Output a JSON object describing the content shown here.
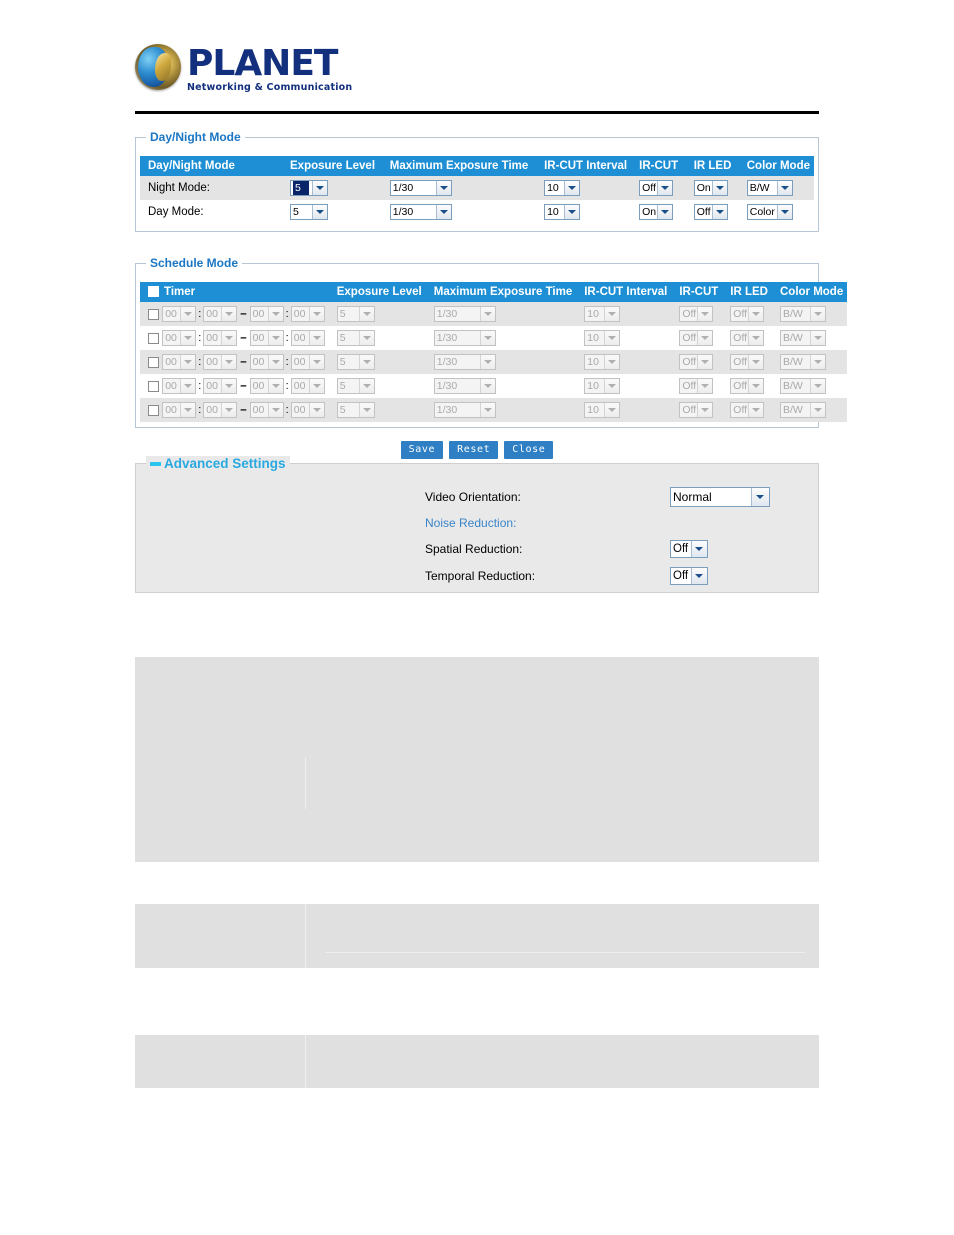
{
  "brand": {
    "name": "PLANET",
    "tagline": "Networking & Communication",
    "logo_icon": "planet-globe-logo",
    "brand_color": "#13307e"
  },
  "theme": {
    "header_blue": "#1e8fd5",
    "legend_blue": "#1b76c3",
    "accent_cyan": "#29a9e0",
    "button_blue": "#2e7fc4",
    "row_alt": "#e4e4e4",
    "panel_border": "#b6c6d4",
    "block_gray": "#e0e0e0"
  },
  "daynight": {
    "legend": "Day/Night Mode",
    "columns": [
      "Day/Night Mode",
      "Exposure Level",
      "Maximum Exposure Time",
      "IR-CUT Interval",
      "IR-CUT",
      "IR LED",
      "Color Mode"
    ],
    "rows": [
      {
        "label": "Night Mode:",
        "exposure_level": "5",
        "exposure_level_focused": true,
        "max_exposure_time": "1/30",
        "ircut_interval": "10",
        "ircut": "Off",
        "irled": "On",
        "color_mode": "B/W"
      },
      {
        "label": "Day Mode:",
        "exposure_level": "5",
        "exposure_level_focused": false,
        "max_exposure_time": "1/30",
        "ircut_interval": "10",
        "ircut": "On",
        "irled": "Off",
        "color_mode": "Color"
      }
    ]
  },
  "schedule": {
    "legend": "Schedule Mode",
    "columns": [
      "Timer",
      "Exposure Level",
      "Maximum Exposure Time",
      "IR-CUT Interval",
      "IR-CUT",
      "IR LED",
      "Color Mode"
    ],
    "time_separator": ":",
    "range_separator": "–",
    "rows": [
      {
        "checked": false,
        "start_hour": "00",
        "start_min": "00",
        "end_hour": "00",
        "end_min": "00",
        "exposure_level": "5",
        "max_exposure_time": "1/30",
        "ircut_interval": "10",
        "ircut": "Off",
        "irled": "Off",
        "color_mode": "B/W"
      },
      {
        "checked": false,
        "start_hour": "00",
        "start_min": "00",
        "end_hour": "00",
        "end_min": "00",
        "exposure_level": "5",
        "max_exposure_time": "1/30",
        "ircut_interval": "10",
        "ircut": "Off",
        "irled": "Off",
        "color_mode": "B/W"
      },
      {
        "checked": false,
        "start_hour": "00",
        "start_min": "00",
        "end_hour": "00",
        "end_min": "00",
        "exposure_level": "5",
        "max_exposure_time": "1/30",
        "ircut_interval": "10",
        "ircut": "Off",
        "irled": "Off",
        "color_mode": "B/W"
      },
      {
        "checked": false,
        "start_hour": "00",
        "start_min": "00",
        "end_hour": "00",
        "end_min": "00",
        "exposure_level": "5",
        "max_exposure_time": "1/30",
        "ircut_interval": "10",
        "ircut": "Off",
        "irled": "Off",
        "color_mode": "B/W"
      },
      {
        "checked": false,
        "start_hour": "00",
        "start_min": "00",
        "end_hour": "00",
        "end_min": "00",
        "exposure_level": "5",
        "max_exposure_time": "1/30",
        "ircut_interval": "10",
        "ircut": "Off",
        "irled": "Off",
        "color_mode": "B/W"
      }
    ]
  },
  "buttons": {
    "save": "Save",
    "reset": "Reset",
    "close": "Close"
  },
  "advanced": {
    "legend": "Advanced Settings",
    "collapse_icon": "minus-collapse-icon",
    "video_orientation_label": "Video Orientation:",
    "video_orientation_value": "Normal",
    "noise_reduction_label": "Noise Reduction:",
    "spatial_label": "Spatial Reduction:",
    "spatial_value": "Off",
    "temporal_label": "Temporal Reduction:",
    "temporal_value": "Off"
  }
}
